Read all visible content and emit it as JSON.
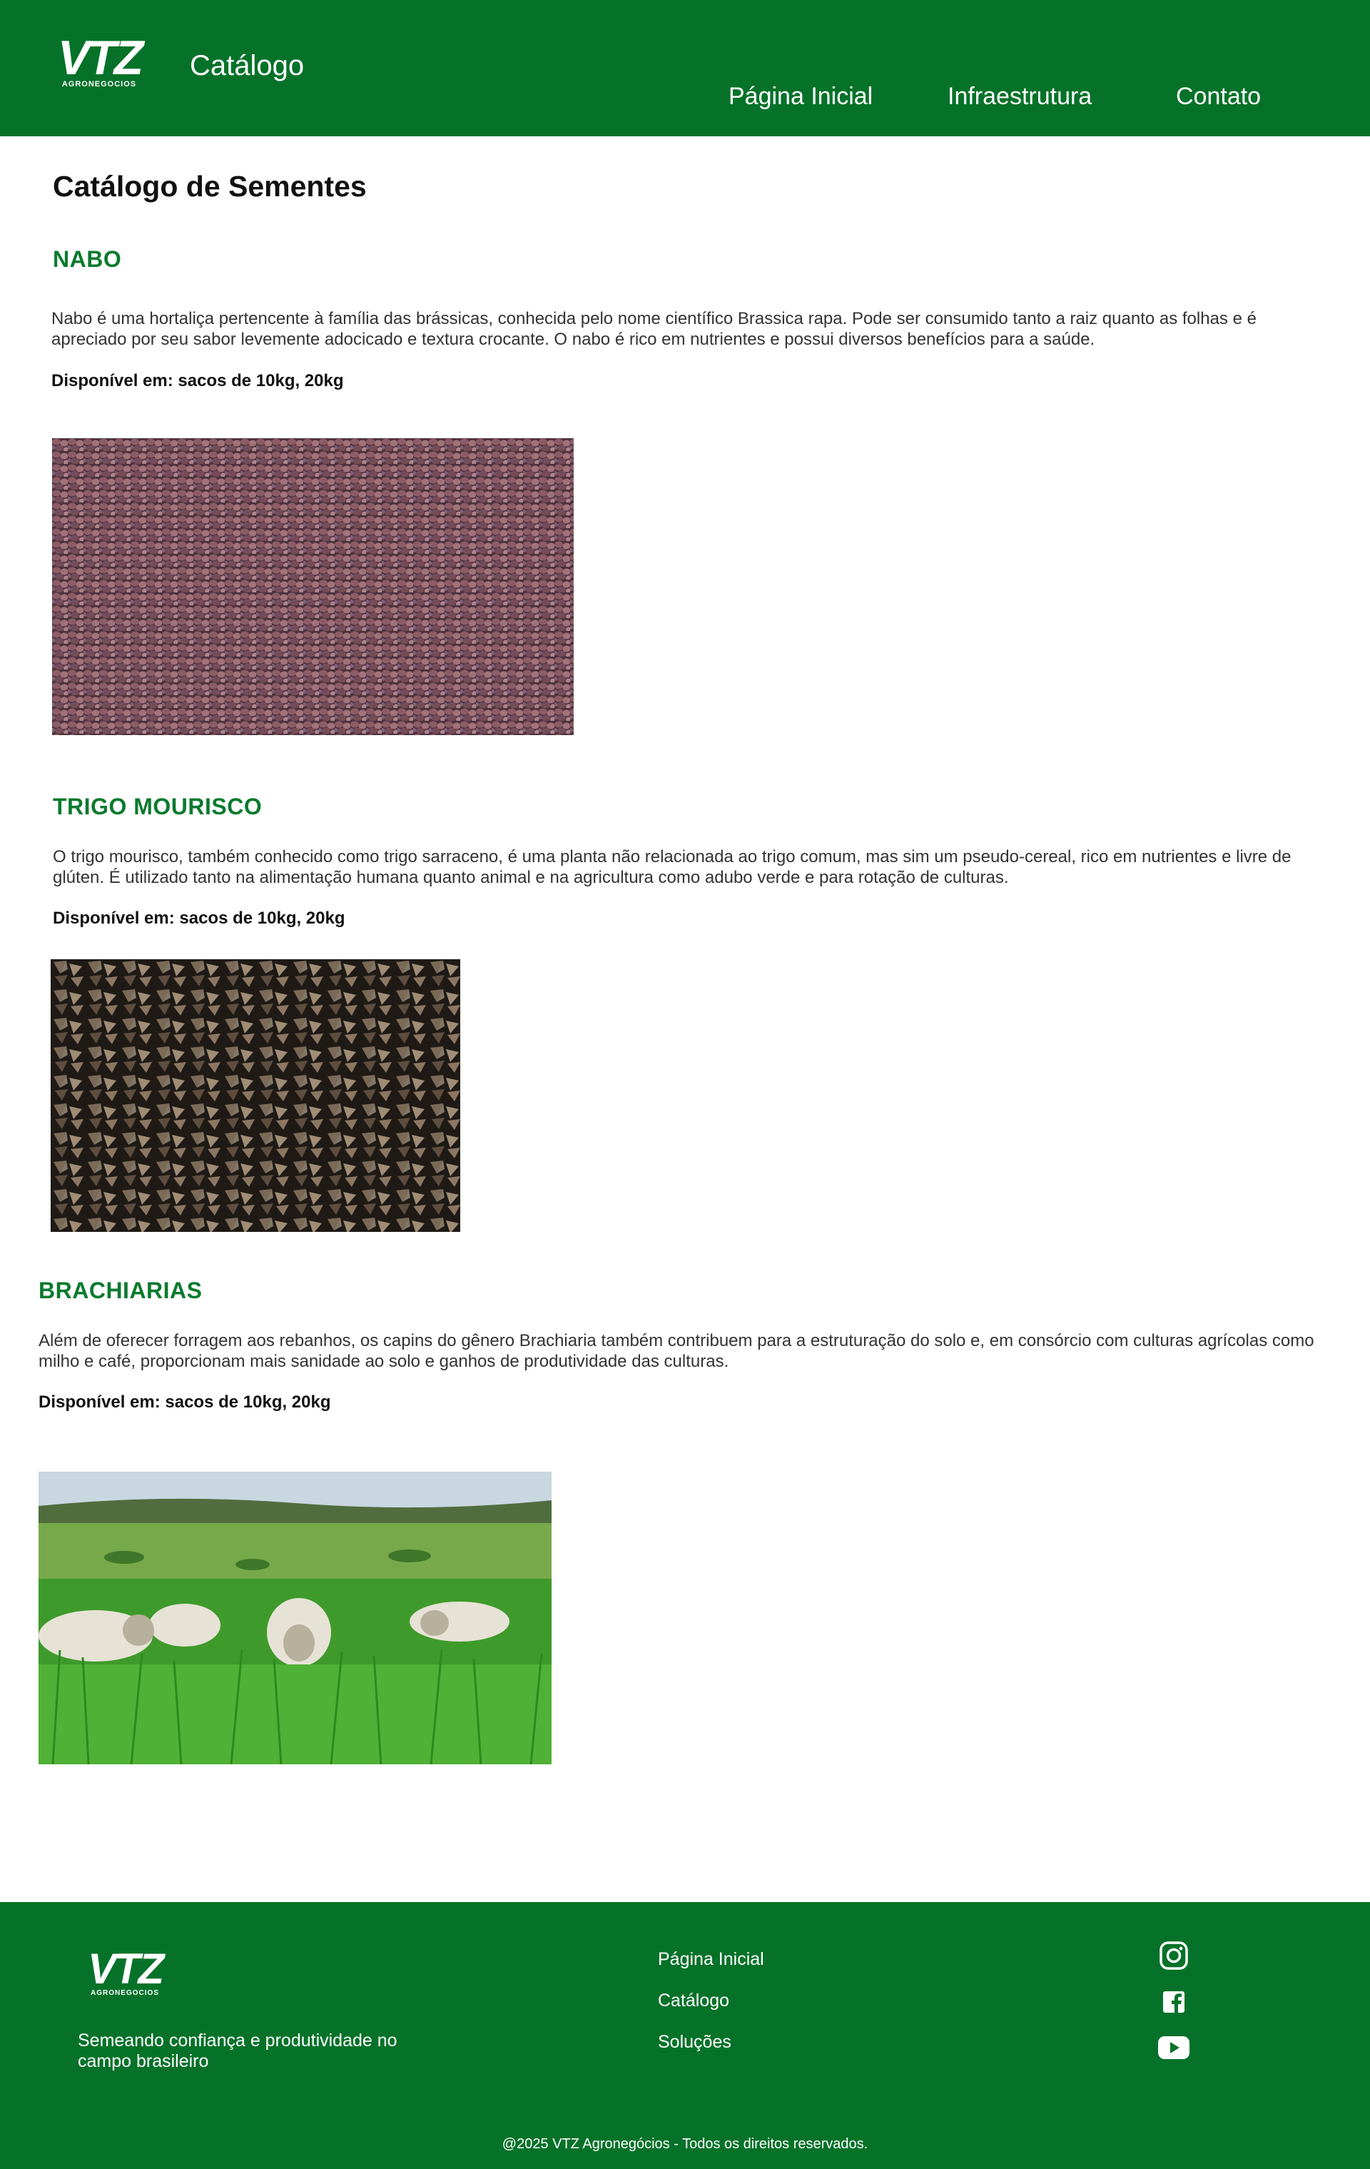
{
  "header": {
    "logo_text": "VTZ",
    "logo_subtext": "AGRONEGOCIOS",
    "title": "Catálogo",
    "nav": [
      {
        "label": "Página Inicial"
      },
      {
        "label": "Infraestrutura"
      },
      {
        "label": "Contato"
      }
    ]
  },
  "main": {
    "page_title": "Catálogo de Sementes",
    "sections": [
      {
        "title": "NABO",
        "description": "Nabo é uma hortaliça pertencente à família das brássicas, conhecida pelo nome científico Brassica rapa. Pode ser consumido tanto a raiz quanto as folhas e é apreciado por seu sabor levemente adocicado e textura crocante. O nabo é rico em nutrientes e possui diversos benefícios para a saúde.",
        "availability": "Disponível em: sacos de 10kg, 20kg"
      },
      {
        "title": "TRIGO MOURISCO",
        "description": "O trigo mourisco, também conhecido como trigo sarraceno, é uma planta não relacionada ao trigo comum, mas sim um pseudo-cereal, rico em nutrientes e livre de glúten. É utilizado tanto na alimentação humana quanto animal e na agricultura como adubo verde e para rotação de culturas.",
        "availability": "Disponível em: sacos de 10kg, 20kg"
      },
      {
        "title": "BRACHIARIAS",
        "description": "Além de oferecer forragem aos rebanhos, os capins do gênero Brachiaria também contribuem para a estruturação do solo e, em consórcio com culturas agrícolas como milho e café, proporcionam mais sanidade ao solo e ganhos de produtividade das culturas.",
        "availability": "Disponível em: sacos de 10kg, 20kg"
      }
    ]
  },
  "footer": {
    "logo_text": "VTZ",
    "logo_subtext": "AGRONEGOCIOS",
    "tagline": "Semeando confiança e produtividade no campo brasileiro",
    "links": [
      {
        "label": "Página Inicial"
      },
      {
        "label": "Catálogo"
      },
      {
        "label": "Soluções"
      }
    ],
    "social_icons": [
      "instagram-icon",
      "facebook-icon",
      "youtube-icon"
    ],
    "copyright": "@2025 VTZ Agronegócios - Todos os direitos reservados."
  },
  "colors": {
    "brand_green": "#067229",
    "section_title_green": "#0b7a2e",
    "text": "#333333"
  }
}
